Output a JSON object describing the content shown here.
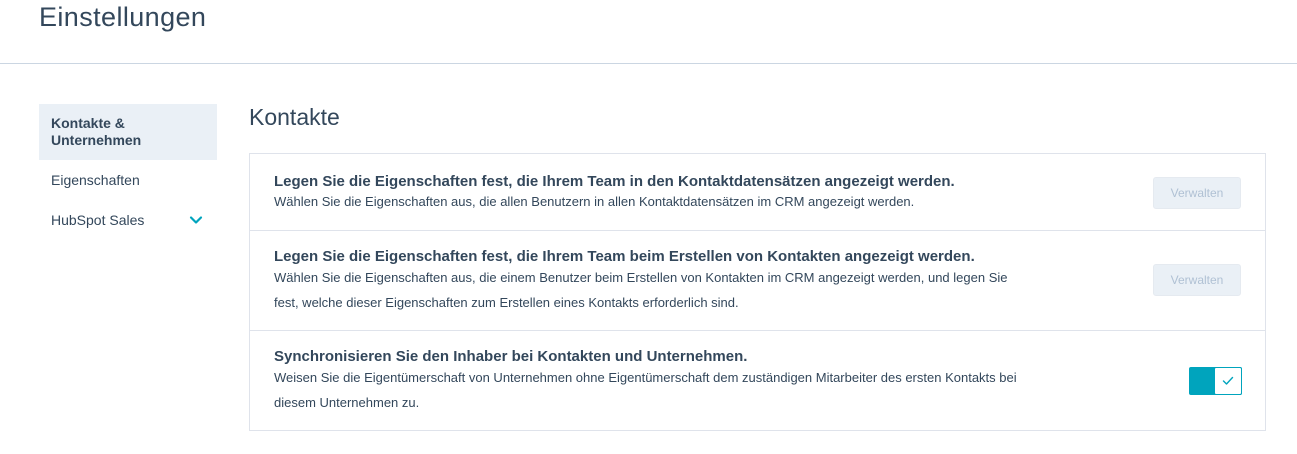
{
  "header": {
    "title": "Einstellungen"
  },
  "sidebar": {
    "items": [
      {
        "label": "Kontakte & Unternehmen",
        "active": true
      },
      {
        "label": "Eigenschaften",
        "active": false
      },
      {
        "label": "HubSpot Sales",
        "active": false,
        "icon": "chevron-down-icon"
      }
    ]
  },
  "main": {
    "title": "Kontakte",
    "rows": [
      {
        "title": "Legen Sie die Eigenschaften fest, die Ihrem Team in den Kontaktdatensätzen angezeigt werden.",
        "description": "Wählen Sie die Eigenschaften aus, die allen Benutzern in allen Kontaktdatensätzen im CRM angezeigt werden.",
        "button_label": "Verwalten"
      },
      {
        "title": "Legen Sie die Eigenschaften fest, die Ihrem Team beim Erstellen von Kontakten angezeigt werden.",
        "description": "Wählen Sie die Eigenschaften aus, die einem Benutzer beim Erstellen von Kontakten im CRM angezeigt werden, und legen Sie fest, welche dieser Eigenschaften zum Erstellen eines Kontakts erforderlich sind.",
        "button_label": "Verwalten"
      },
      {
        "title": "Synchronisieren Sie den Inhaber bei Kontakten und Unternehmen.",
        "description": "Weisen Sie die Eigentümerschaft von Unternehmen ohne Eigentümerschaft dem zuständigen Mitarbeiter des ersten Kontakts bei diesem Unternehmen zu.",
        "toggle_on": true
      }
    ]
  },
  "colors": {
    "accent": "#00a4bd",
    "text": "#33475b",
    "border": "#dfe3eb",
    "active_bg": "#eaf0f6"
  }
}
